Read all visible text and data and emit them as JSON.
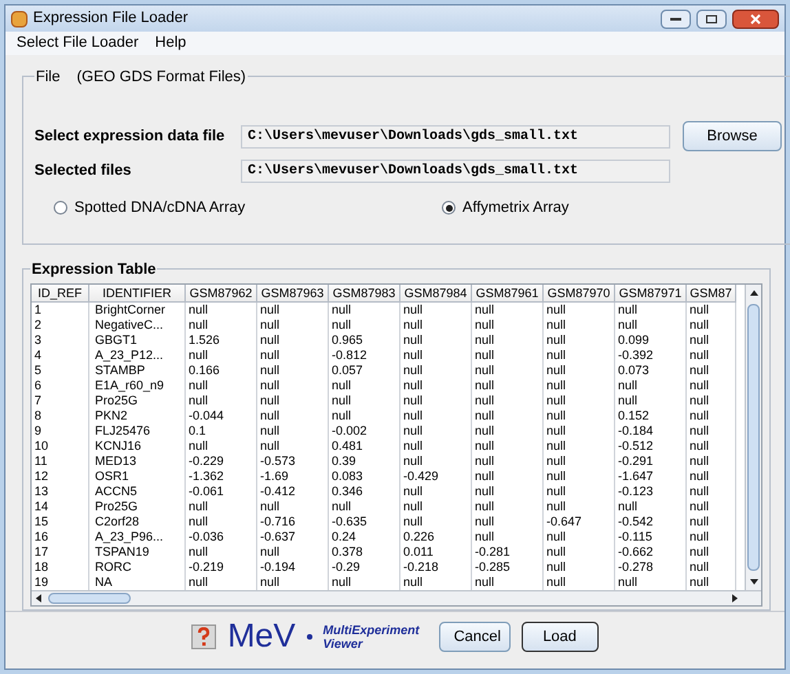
{
  "window": {
    "title": "Expression File Loader"
  },
  "menu": [
    "Select File Loader",
    "Help"
  ],
  "file_group": {
    "title": "File",
    "subtitle": "(GEO GDS Format Files)",
    "fields": [
      {
        "label": "Select expression data file",
        "value": "C:\\Users\\mevuser\\Downloads\\gds_small.txt"
      },
      {
        "label": "Selected files",
        "value": "C:\\Users\\mevuser\\Downloads\\gds_small.txt"
      }
    ],
    "browse_button": "Browse",
    "array_types": [
      {
        "label": "Spotted DNA/cDNA Array",
        "selected": false
      },
      {
        "label": "Affymetrix Array",
        "selected": true
      }
    ]
  },
  "table": {
    "title": "Expression Table",
    "columns": [
      "ID_REF",
      "IDENTIFIER",
      "GSM87962",
      "GSM87963",
      "GSM87983",
      "GSM87984",
      "GSM87961",
      "GSM87970",
      "GSM87971",
      "GSM87"
    ],
    "rows": [
      [
        "1",
        "BrightCorner",
        "null",
        "null",
        "null",
        "null",
        "null",
        "null",
        "null",
        "null"
      ],
      [
        "2",
        "NegativeC...",
        "null",
        "null",
        "null",
        "null",
        "null",
        "null",
        "null",
        "null"
      ],
      [
        "3",
        "GBGT1",
        "1.526",
        "null",
        "0.965",
        "null",
        "null",
        "null",
        "0.099",
        "null"
      ],
      [
        "4",
        "A_23_P12...",
        "null",
        "null",
        "-0.812",
        "null",
        "null",
        "null",
        "-0.392",
        "null"
      ],
      [
        "5",
        "STAMBP",
        "0.166",
        "null",
        "0.057",
        "null",
        "null",
        "null",
        "0.073",
        "null"
      ],
      [
        "6",
        "E1A_r60_n9",
        "null",
        "null",
        "null",
        "null",
        "null",
        "null",
        "null",
        "null"
      ],
      [
        "7",
        "Pro25G",
        "null",
        "null",
        "null",
        "null",
        "null",
        "null",
        "null",
        "null"
      ],
      [
        "8",
        "PKN2",
        "-0.044",
        "null",
        "null",
        "null",
        "null",
        "null",
        "0.152",
        "null"
      ],
      [
        "9",
        "FLJ25476",
        "0.1",
        "null",
        "-0.002",
        "null",
        "null",
        "null",
        "-0.184",
        "null"
      ],
      [
        "10",
        "KCNJ16",
        "null",
        "null",
        "0.481",
        "null",
        "null",
        "null",
        "-0.512",
        "null"
      ],
      [
        "11",
        "MED13",
        "-0.229",
        "-0.573",
        "0.39",
        "null",
        "null",
        "null",
        "-0.291",
        "null"
      ],
      [
        "12",
        "OSR1",
        "-1.362",
        "-1.69",
        "0.083",
        "-0.429",
        "null",
        "null",
        "-1.647",
        "null"
      ],
      [
        "13",
        "ACCN5",
        "-0.061",
        "-0.412",
        "0.346",
        "null",
        "null",
        "null",
        "-0.123",
        "null"
      ],
      [
        "14",
        "Pro25G",
        "null",
        "null",
        "null",
        "null",
        "null",
        "null",
        "null",
        "null"
      ],
      [
        "15",
        "C2orf28",
        "null",
        "-0.716",
        "-0.635",
        "null",
        "null",
        "-0.647",
        "-0.542",
        "null"
      ],
      [
        "16",
        "A_23_P96...",
        "-0.036",
        "-0.637",
        "0.24",
        "0.226",
        "null",
        "null",
        "-0.115",
        "null"
      ],
      [
        "17",
        "TSPAN19",
        "null",
        "null",
        "0.378",
        "0.011",
        "-0.281",
        "null",
        "-0.662",
        "null"
      ],
      [
        "18",
        "RORC",
        "-0.219",
        "-0.194",
        "-0.29",
        "-0.218",
        "-0.285",
        "null",
        "-0.278",
        "null"
      ],
      [
        "19",
        "NA",
        "null",
        "null",
        "null",
        "null",
        "null",
        "null",
        "null",
        "null"
      ]
    ]
  },
  "footer": {
    "logo": "MeV",
    "logo_caption_1": "MultiExperiment",
    "logo_caption_2": "Viewer",
    "buttons": [
      "Cancel",
      "Load"
    ]
  }
}
